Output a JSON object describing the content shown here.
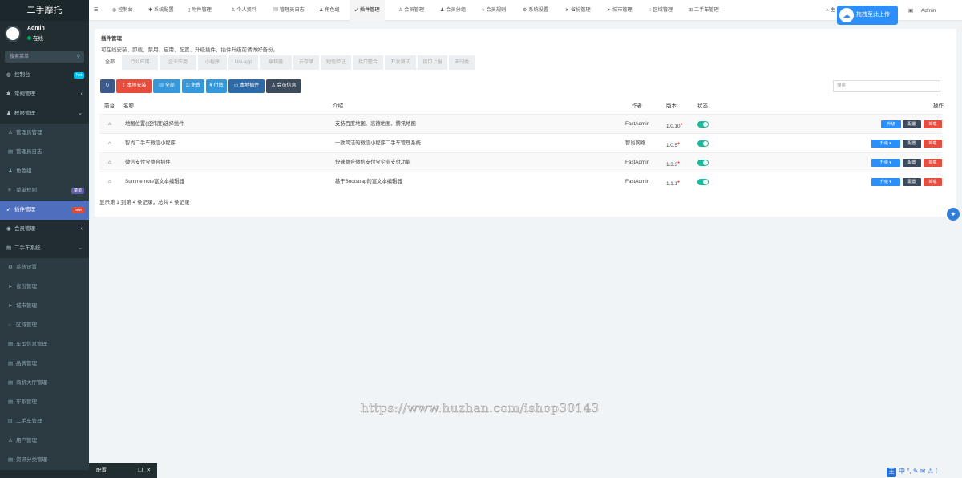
{
  "app": {
    "title": "二手摩托",
    "user_name": "Admin",
    "user_status": "在线",
    "search_placeholder": "搜索菜单"
  },
  "sidebar": [
    {
      "label": "控制台",
      "icon": "dashboard-icon",
      "badge": "hot",
      "badge_color": "#00c0ef"
    },
    {
      "label": "常规管理",
      "icon": "cog-icon",
      "arrow": "‹"
    },
    {
      "label": "权限管理",
      "icon": "group-icon",
      "arrow": "⌄"
    },
    {
      "label": "管理员管理",
      "icon": "user-icon",
      "sub": true
    },
    {
      "label": "管理员日志",
      "icon": "list-icon",
      "sub": true
    },
    {
      "label": "角色组",
      "icon": "group-icon",
      "sub": true
    },
    {
      "label": "菜单规则",
      "icon": "bars-icon",
      "sub": true,
      "badge": "菜单",
      "badge_color": "#605ca8"
    },
    {
      "label": "插件管理",
      "icon": "rocket-icon",
      "active": true,
      "badge": "new",
      "badge_color": "#dd4b39"
    },
    {
      "label": "会员管理",
      "icon": "user-circle-icon",
      "arrow": "‹"
    },
    {
      "label": "二手车系统",
      "icon": "list-icon",
      "arrow": "⌄"
    },
    {
      "label": "系统设置",
      "icon": "cogs-icon",
      "sub": true
    },
    {
      "label": "省份管理",
      "icon": "send-icon",
      "sub": true
    },
    {
      "label": "城市管理",
      "icon": "send-icon",
      "sub": true
    },
    {
      "label": "区域管理",
      "icon": "circle-icon",
      "sub": true
    },
    {
      "label": "车型信息管理",
      "icon": "list-icon",
      "sub": true
    },
    {
      "label": "品牌管理",
      "icon": "list-icon",
      "sub": true
    },
    {
      "label": "商机大厅管理",
      "icon": "list-icon",
      "sub": true
    },
    {
      "label": "车系管理",
      "icon": "list-icon",
      "sub": true
    },
    {
      "label": "二手车管理",
      "icon": "sitemap-icon",
      "sub": true
    },
    {
      "label": "用户管理",
      "icon": "user-icon",
      "sub": true
    },
    {
      "label": "资讯分类管理",
      "icon": "list-icon",
      "sub": true
    }
  ],
  "topnav": [
    {
      "label": "控制台",
      "icon": "dashboard-icon"
    },
    {
      "label": "系统配置",
      "icon": "cog-icon"
    },
    {
      "label": "附件管理",
      "icon": "file-icon"
    },
    {
      "label": "个人资料",
      "icon": "user-icon"
    },
    {
      "label": "管理员日志",
      "icon": "list-icon"
    },
    {
      "label": "角色组",
      "icon": "group-icon"
    },
    {
      "label": "插件管理",
      "icon": "rocket-icon",
      "active": true
    },
    {
      "label": "会员管理",
      "icon": "user-icon"
    },
    {
      "label": "会员分组",
      "icon": "group-icon"
    },
    {
      "label": "会员规则",
      "icon": "circle-icon"
    },
    {
      "label": "系统设置",
      "icon": "cogs-icon"
    },
    {
      "label": "省份管理",
      "icon": "send-icon"
    },
    {
      "label": "城市管理",
      "icon": "send-icon"
    },
    {
      "label": "区域管理",
      "icon": "circle-icon"
    },
    {
      "label": "二手车管理",
      "icon": "sitemap-icon"
    }
  ],
  "topright": {
    "home": "主",
    "upload_label": "拖拽至此上传",
    "admin": "Admin"
  },
  "panel": {
    "title": "插件管理",
    "desc": "可在线安装、卸载、禁用、启用、配置、升级插件，插件升级前请做好备份。"
  },
  "tabs": [
    "全部",
    "行业应用",
    "企业应用",
    "小程序",
    "Uni-app",
    "编辑器",
    "云存储",
    "短信验证",
    "接口整合",
    "开发测试",
    "接口上报",
    "未归类"
  ],
  "buttons": [
    {
      "label": "",
      "icon": "refresh-icon",
      "color": "#3c5a8c"
    },
    {
      "label": "本地安装",
      "icon": "upload-icon",
      "color": "#e74c3c"
    },
    {
      "label": "全部",
      "icon": "list-icon",
      "color": "#3498db"
    },
    {
      "label": "免费",
      "icon": "gift-icon",
      "color": "#3498db"
    },
    {
      "label": "付费",
      "icon": "rmb-icon",
      "color": "#3498db"
    },
    {
      "label": "本地插件",
      "icon": "laptop-icon",
      "color": "#2c6aa8"
    },
    {
      "label": "会员信息",
      "icon": "user-icon",
      "color": "#3c4b5c"
    }
  ],
  "search": {
    "placeholder": "搜索"
  },
  "table": {
    "headers": {
      "frontend": "前台",
      "name": "名称",
      "intro": "介绍",
      "author": "作者",
      "version": "版本",
      "status": "状态",
      "actions": "操作"
    },
    "rows": [
      {
        "name": "地图位置(经纬度)选择插件",
        "intro": "支持百度地图、高德地图、腾讯地图",
        "author": "FastAdmin",
        "version": "1.0.10",
        "enabled": true,
        "upgrade_dropdown": false
      },
      {
        "name": "智尚二手车微信小程序",
        "intro": "一款简洁的微信小程序二手车管理系统",
        "author": "智尚网络",
        "version": "1.0.5",
        "enabled": true,
        "upgrade_dropdown": true
      },
      {
        "name": "微信支付宝整合插件",
        "intro": "快速整合微信支付宝企业支付功能",
        "author": "FastAdmin",
        "version": "1.3.3",
        "enabled": true,
        "upgrade_dropdown": true
      },
      {
        "name": "Summernote富文本编辑器",
        "intro": "基于Bootstrap的富文本编辑器",
        "author": "FastAdmin",
        "version": "1.1.1",
        "enabled": true,
        "upgrade_dropdown": true
      }
    ],
    "action_labels": {
      "upgrade": "升级",
      "config": "配置",
      "uninstall": "卸载"
    },
    "footer": "显示第 1 到第 4 条记录，总共 4 条记录"
  },
  "mini_window": {
    "label": "配置"
  },
  "watermark": "https://www.huzhan.com/ishop30143",
  "ime": {
    "key": "王",
    "text": "中 °, ✎ ✉ ⁂ ⁞"
  }
}
